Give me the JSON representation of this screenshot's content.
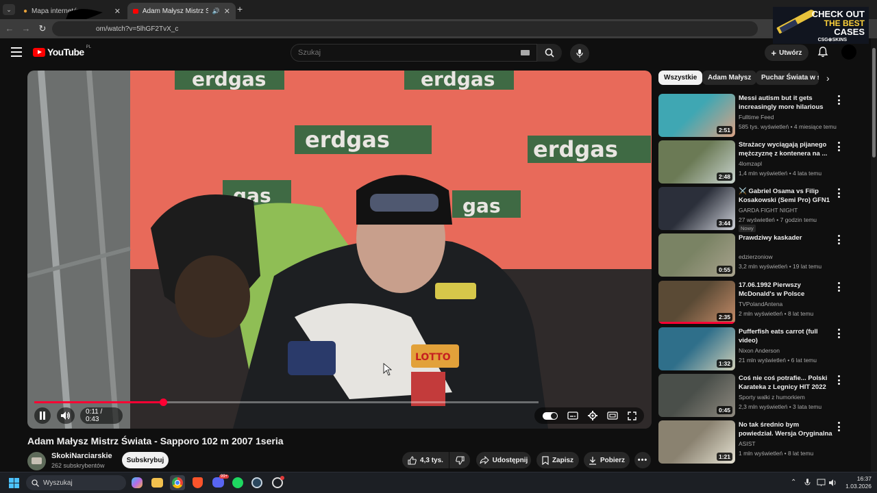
{
  "browser": {
    "tabs": [
      {
        "title": "Mapa internetów",
        "active": false
      },
      {
        "title": "Adam Małysz Mistrz Świata",
        "active": true
      }
    ],
    "new_tab": "+",
    "url": "om/watch?v=5lhGF2TvX_c"
  },
  "ad": {
    "line1": "CHECK OUT",
    "line2": "THE BEST",
    "line3": "CASES",
    "brand": "CSG⊗SKINS"
  },
  "header": {
    "logo_text": "YouTube",
    "country": "PL",
    "search_placeholder": "Szukaj",
    "create_label": "Utwórz"
  },
  "player": {
    "video_text": [
      "erdgas",
      "erdgas",
      "erdgas",
      "erdgas",
      "gas",
      "gas",
      "LOTTO"
    ],
    "time_current": "0:11",
    "time_separator": "/",
    "time_total": "0:43",
    "progress_fraction": 0.256
  },
  "video": {
    "title": "Adam Małysz Mistrz Świata - Sapporo 102 m 2007 1seria",
    "channel": "SkokiNarciarskie",
    "subscribers": "262 subskrybentów",
    "subscribe_label": "Subskrybuj",
    "likes": "4,3 tys.",
    "share_label": "Udostępnij",
    "save_label": "Zapisz",
    "download_label": "Pobierz"
  },
  "chips": [
    "Wszystkie",
    "Adam Małysz",
    "Puchar Świata w skokach"
  ],
  "recommendations": [
    {
      "title": "Messi autism but it gets increasingly more hilarious",
      "channel": "Fulltime Feed",
      "meta": "585 tys. wyświetleń • 4 miesiące temu",
      "duration": "2:51",
      "colors": [
        "#3fa7b3",
        "#d9a184"
      ]
    },
    {
      "title": "Strażacy wyciągają pijanego mężczyznę z kontenera na ...",
      "channel": "4lomzapl",
      "meta": "1,4 mln wyświetleń • 4 lata temu",
      "duration": "2:48",
      "colors": [
        "#6b7a55",
        "#c9d4cf"
      ]
    },
    {
      "title": "⚔️ Gabriel Osama vs Filip Kosakowski (Semi Pro) GFN1 ...",
      "channel": "GARDA FIGHT NIGHT",
      "meta": "27 wyświetleń • 7 godzin temu",
      "badge": "Nowy",
      "duration": "3:44",
      "colors": [
        "#2b2f3a",
        "#cfd2d9"
      ]
    },
    {
      "title": "Prawdziwy kaskader",
      "channel": "edzierzoniow",
      "meta": "3,2 mln wyświetleń • 19 lat temu",
      "duration": "0:55",
      "colors": [
        "#7a8364",
        "#a9a38e"
      ]
    },
    {
      "title": "17.06.1992 Pierwszy McDonald's w Polsce",
      "channel": "TVPolandAntena",
      "meta": "2 mln wyświetleń • 8 lat temu",
      "duration": "2:35",
      "colors": [
        "#5a4a35",
        "#c48b68"
      ]
    },
    {
      "title": "Pufferfish eats carrot (full video)",
      "channel": "Nixon Anderson",
      "meta": "21 mln wyświetleń • 6 lat temu",
      "duration": "1:32",
      "colors": [
        "#2f6f8a",
        "#cfcfb8"
      ]
    },
    {
      "title": "Coś nie coś potrafie... Polski Karateka z Legnicy HIT 2022",
      "channel": "Sporty walki z humorkiem",
      "meta": "2,3 mln wyświetleń • 3 lata temu",
      "duration": "0:45",
      "colors": [
        "#4a4f4a",
        "#8f8a80"
      ]
    },
    {
      "title": "No tak średnio bym powiedział. Wersja Oryginalna oraz wersja...",
      "channel": "ASIST",
      "meta": "1 mln wyświetleń • 8 lat temu",
      "duration": "1:21",
      "colors": [
        "#8a8270",
        "#e5e1d2"
      ]
    }
  ],
  "taskbar": {
    "search_label": "Wyszukaj",
    "time": "16:37",
    "date": "1.03.2026",
    "discord_badge": "99+"
  }
}
